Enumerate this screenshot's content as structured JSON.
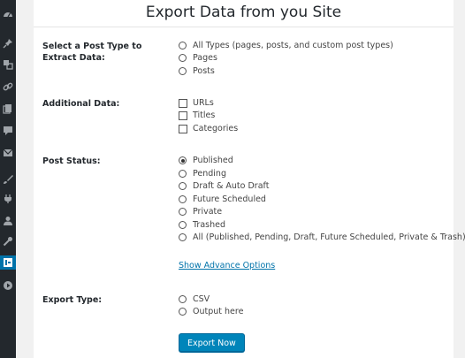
{
  "page": {
    "title": "Export Data from you Site"
  },
  "sidebar": {
    "icons": [
      "dashboard-icon",
      "pin-icon",
      "media-icon",
      "links-icon",
      "pages-icon",
      "comments-icon",
      "mail-icon",
      "appearance-icon",
      "plugins-icon",
      "users-icon",
      "tools-icon",
      "export-plugin-icon",
      "play-icon"
    ],
    "active": "export-plugin-icon"
  },
  "post_type": {
    "label": "Select a Post Type to Extract Data:",
    "options": [
      "All Types (pages, posts, and custom post types)",
      "Pages",
      "Posts"
    ]
  },
  "additional_data": {
    "label": "Additional Data:",
    "options": [
      "URLs",
      "Titles",
      "Categories"
    ]
  },
  "post_status": {
    "label": "Post Status:",
    "options": [
      "Published",
      "Pending",
      "Draft & Auto Draft",
      "Future Scheduled",
      "Private",
      "Trashed",
      "All (Published, Pending, Draft, Future Scheduled, Private & Trash)"
    ],
    "selected": "Published"
  },
  "advance_link": "Show Advance Options",
  "export_type": {
    "label": "Export Type:",
    "options": [
      "CSV",
      "Output here"
    ]
  },
  "export_button": "Export Now",
  "colors": {
    "sidebar_bg": "#23282d",
    "accent": "#0073aa",
    "button": "#0085ba"
  }
}
